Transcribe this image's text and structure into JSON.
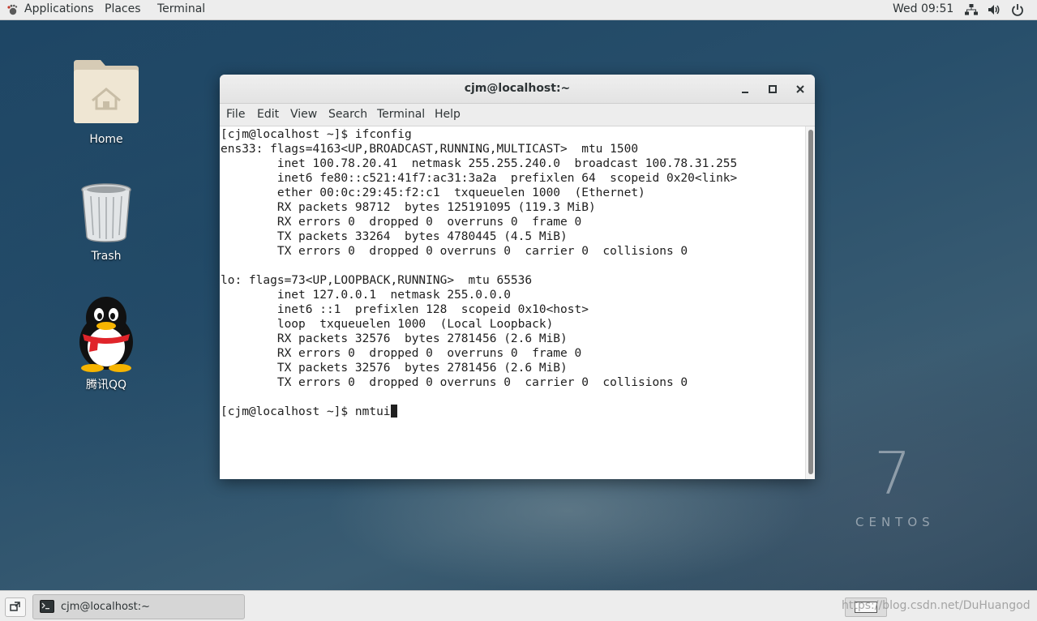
{
  "top_panel": {
    "applications_label": "Applications",
    "places_label": "Places",
    "terminal_label": "Terminal",
    "clock": "Wed 09:51",
    "tray_icons": [
      "network-icon",
      "volume-icon",
      "power-icon"
    ]
  },
  "desktop_icons": {
    "home_label": "Home",
    "trash_label": "Trash",
    "qq_label": "腾讯QQ"
  },
  "branding": {
    "version": "7",
    "name": "CENTOS"
  },
  "terminal_window": {
    "title": "cjm@localhost:~",
    "menu": {
      "file": "File",
      "edit": "Edit",
      "view": "View",
      "search": "Search",
      "terminal": "Terminal",
      "help": "Help"
    },
    "lines": [
      "[cjm@localhost ~]$ ifconfig",
      "ens33: flags=4163<UP,BROADCAST,RUNNING,MULTICAST>  mtu 1500",
      "        inet 100.78.20.41  netmask 255.255.240.0  broadcast 100.78.31.255",
      "        inet6 fe80::c521:41f7:ac31:3a2a  prefixlen 64  scopeid 0x20<link>",
      "        ether 00:0c:29:45:f2:c1  txqueuelen 1000  (Ethernet)",
      "        RX packets 98712  bytes 125191095 (119.3 MiB)",
      "        RX errors 0  dropped 0  overruns 0  frame 0",
      "        TX packets 33264  bytes 4780445 (4.5 MiB)",
      "        TX errors 0  dropped 0 overruns 0  carrier 0  collisions 0",
      "",
      "lo: flags=73<UP,LOOPBACK,RUNNING>  mtu 65536",
      "        inet 127.0.0.1  netmask 255.0.0.0",
      "        inet6 ::1  prefixlen 128  scopeid 0x10<host>",
      "        loop  txqueuelen 1000  (Local Loopback)",
      "        RX packets 32576  bytes 2781456 (2.6 MiB)",
      "        RX errors 0  dropped 0  overruns 0  frame 0",
      "        TX packets 32576  bytes 2781456 (2.6 MiB)",
      "        TX errors 0  dropped 0 overruns 0  carrier 0  collisions 0",
      ""
    ],
    "prompt": "[cjm@localhost ~]$ ",
    "current_input": "nmtui"
  },
  "taskbar": {
    "task_label": "cjm@localhost:~",
    "watermark": "https://blog.csdn.net/DuHuangod"
  },
  "colors": {
    "panel_bg": "#ededed",
    "desktop_accent": "#284f6b"
  }
}
